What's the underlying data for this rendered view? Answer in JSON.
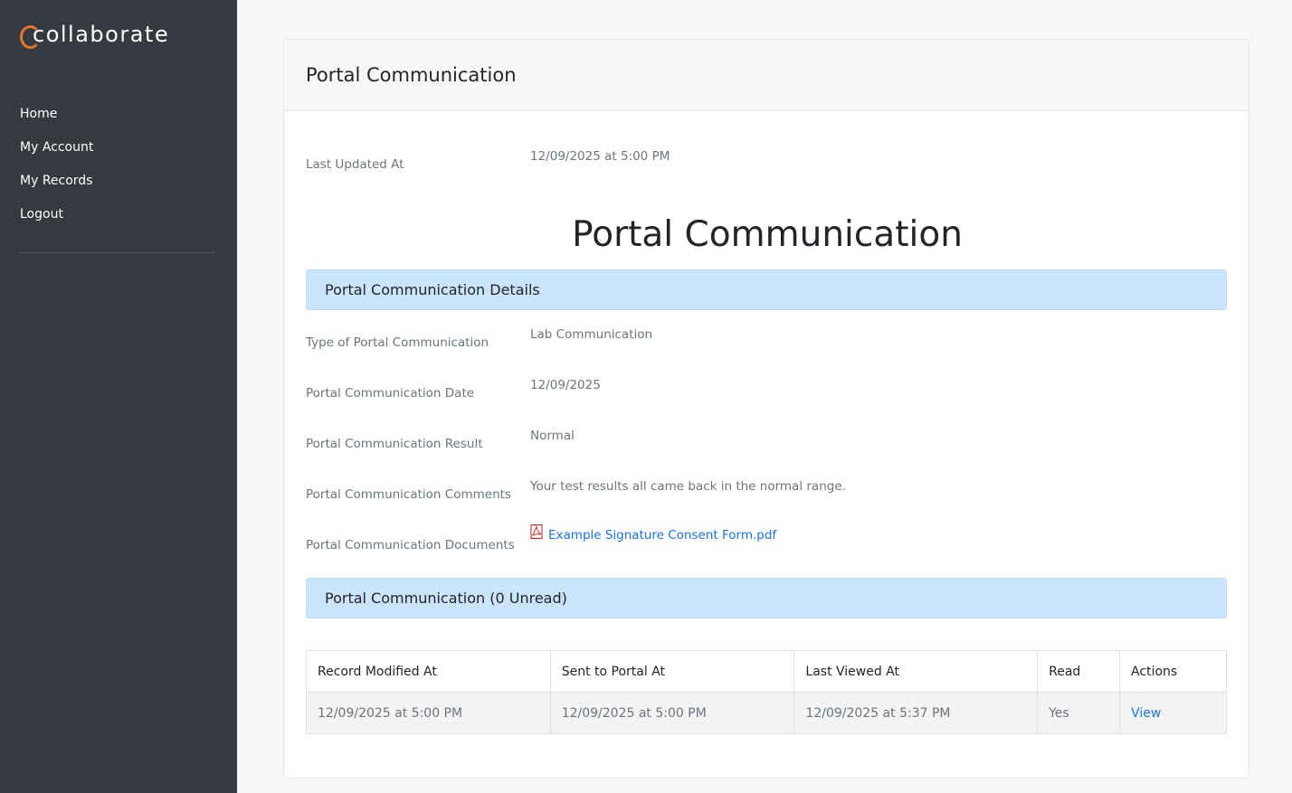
{
  "brand": {
    "name": "collaborate",
    "accent_color": "#e8762b"
  },
  "sidebar": {
    "items": [
      {
        "label": "Home"
      },
      {
        "label": "My Account"
      },
      {
        "label": "My Records"
      },
      {
        "label": "Logout"
      }
    ]
  },
  "card": {
    "header_title": "Portal Communication",
    "last_updated": {
      "label": "Last Updated At",
      "value": "12/09/2025 at 5:00 PM"
    },
    "main_title": "Portal Communication",
    "details_section": {
      "title": "Portal Communication Details",
      "fields": [
        {
          "label": "Type of Portal Communication",
          "value": "Lab Communication"
        },
        {
          "label": "Portal Communication Date",
          "value": "12/09/2025"
        },
        {
          "label": "Portal Communication Result",
          "value": "Normal"
        },
        {
          "label": "Portal Communication Comments",
          "value": "Your test results all came back in the normal range."
        },
        {
          "label": "Portal Communication Documents",
          "value": "Example Signature Consent Form.pdf",
          "icon": "pdf-icon"
        }
      ]
    },
    "communication_section": {
      "title": "Portal Communication (0 Unread)",
      "table": {
        "headers": [
          "Record Modified At",
          "Sent to Portal At",
          "Last Viewed At",
          "Read",
          "Actions"
        ],
        "rows": [
          [
            "12/09/2025 at 5:00 PM",
            "12/09/2025 at 5:00 PM",
            "12/09/2025 at 5:37 PM",
            "Yes",
            "View"
          ]
        ]
      }
    }
  },
  "colors": {
    "sidebar_bg": "#343a40",
    "section_bg": "#cce5ff",
    "link": "#1a73e8"
  }
}
